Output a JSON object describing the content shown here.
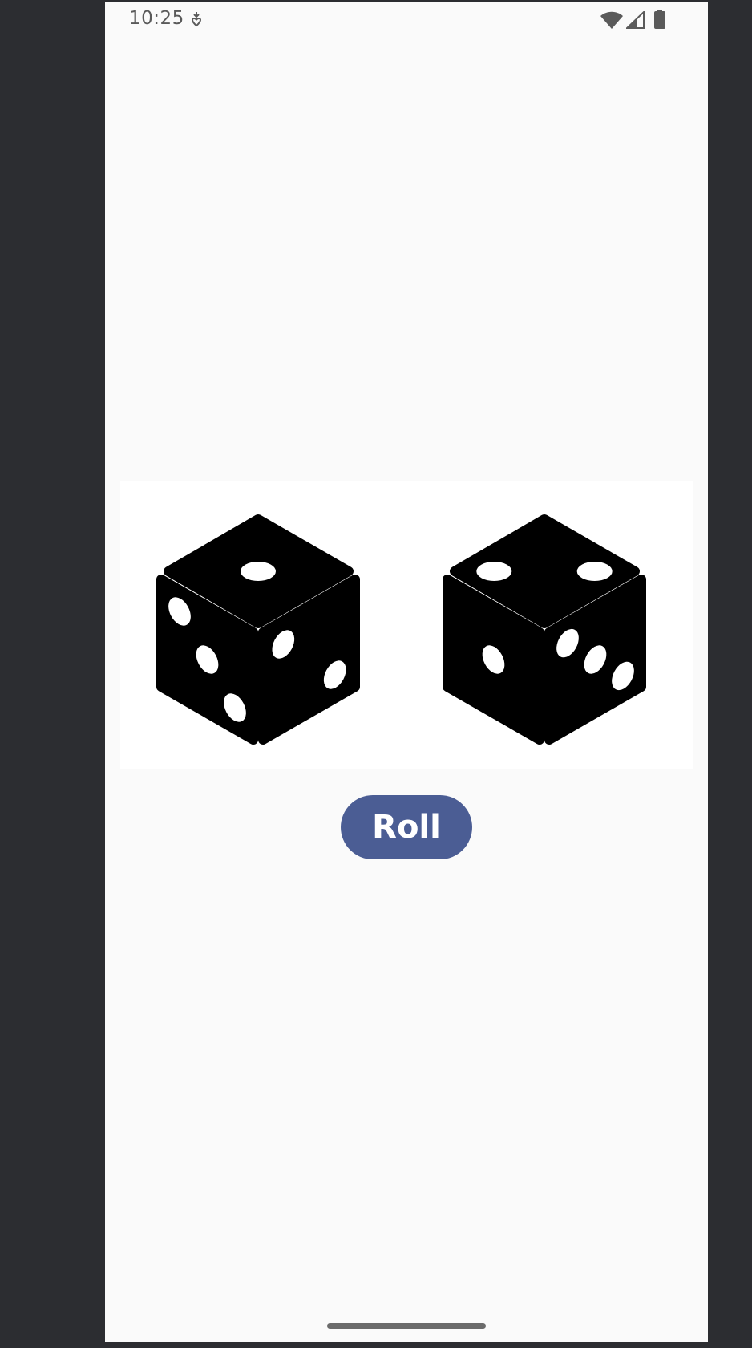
{
  "status_bar": {
    "time": "10:25",
    "icons": [
      "notification-icon",
      "wifi-icon",
      "signal-icon",
      "battery-icon"
    ]
  },
  "dice": [
    {
      "name": "left-die",
      "top_face": 1,
      "left_face": 3,
      "right_face": 2
    },
    {
      "name": "right-die",
      "top_face": 2,
      "left_face": 1,
      "right_face": 3
    }
  ],
  "roll_button": {
    "label": "Roll"
  },
  "colors": {
    "button": "#4b5d94",
    "screen_background": "#fafafa",
    "frame": "#2c2d31",
    "dice": "#000000"
  }
}
